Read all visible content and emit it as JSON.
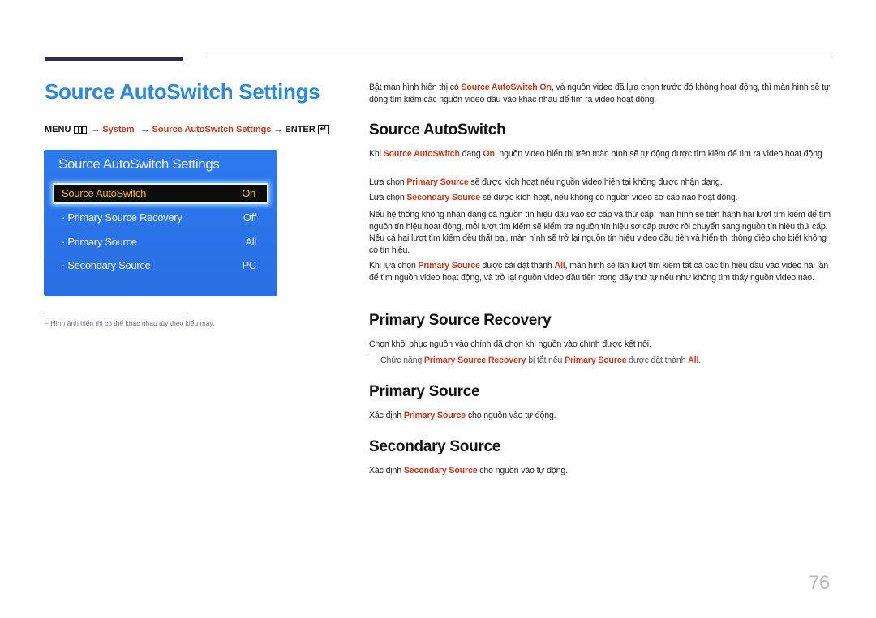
{
  "page": {
    "title": "Source AutoSwitch Settings",
    "page_number": "76"
  },
  "menu_path": {
    "menu_label": "MENU",
    "menu_icon": "menu-grid-icon",
    "arrow": "→",
    "step1": "System",
    "step2": "Source AutoSwitch Settings",
    "enter_label": "ENTER",
    "enter_icon": "enter-icon",
    "enter_glyph": "↵"
  },
  "osd": {
    "title": "Source AutoSwitch Settings",
    "rows": [
      {
        "label": "Source AutoSwitch",
        "value": "On",
        "selected": true
      },
      {
        "label": "· Primary Source Recovery",
        "value": "Off",
        "selected": false
      },
      {
        "label": "· Primary Source",
        "value": "All",
        "selected": false
      },
      {
        "label": "· Secondary Source",
        "value": "PC",
        "selected": false
      }
    ]
  },
  "footnote": "−  Hình ảnh hiển thị có thể khác nhau tùy theo kiểu máy.",
  "colors": {
    "title_blue": "#2a88e6",
    "highlight_red": "#c8381c",
    "osd_blue": "#2d79ee",
    "osd_selected_text": "#f2b820"
  },
  "intro": {
    "t1": "Bật màn hình hiển thị có ",
    "h1": "Source AutoSwitch On",
    "t2": ", và nguồn video đã lựa chọn trước đó không hoạt động, thì màn hình sẽ tự động tìm kiếm các nguồn video đầu vào khác nhau để tìm ra video hoạt động."
  },
  "sections": {
    "autoswitch": {
      "heading": "Source AutoSwitch",
      "p1": {
        "t1": "Khi ",
        "h1": "Source AutoSwitch",
        "t2": " đang ",
        "h2": "On",
        "t3": ", nguồn video hiển thị trên màn hình sẽ tự động được tìm kiếm để tìm ra video hoạt động."
      },
      "p2": {
        "t1": "Lựa chọn ",
        "h1": "Primary Source",
        "t2": " sẽ được kích hoạt nếu nguồn video hiện tại không được nhận dạng."
      },
      "p3": {
        "t1": "Lựa chọn ",
        "h1": "Secondary Source",
        "t2": " sẽ được kích hoạt, nếu không có nguồn video sơ cấp nào hoạt động."
      },
      "p4": "Nếu hệ thống không nhận dạng cả nguồn tín hiệu đầu vào sơ cấp và thứ cấp, màn hình sẽ tiến hành hai lượt tìm kiếm để tìm nguồn tín hiệu hoạt động, mỗi lượt tìm kiếm sẽ kiểm tra nguồn tín hiệu sơ cấp trước rồi chuyển sang nguồn tín hiệu thứ cấp. Nếu cả hai lượt tìm kiếm đều thất bại, màn hình sẽ trở lại nguồn tín hiệu video đầu tiên và hiển thị thông điệp cho biết không có tín hiệu.",
      "p5": {
        "t1": "Khi lựa chọn ",
        "h1": "Primary Source",
        "t2": " được cài đặt thành ",
        "h2": "All",
        "t3": ", màn hình sẽ lần lượt tìm kiếm tất cả các tín hiệu đầu vào video hai lần để tìm nguồn video hoạt động, và trở lại nguồn video đầu tiên trong dãy thứ tự nếu như không tìm thấy nguồn video nào."
      }
    },
    "recovery": {
      "heading": "Primary Source Recovery",
      "p1": "Chọn khôi phục nguồn vào chính đã chọn khi nguồn vào chính được kết nối.",
      "note": {
        "t1": "Chức năng ",
        "h1": "Primary Source Recovery",
        "t2": " bị tắt nếu ",
        "h2": "Primary Source",
        "t3": " được đặt thành ",
        "h3": "All",
        "t4": "."
      }
    },
    "primary": {
      "heading": "Primary Source",
      "p1": {
        "t1": "Xác định ",
        "h1": "Primary Source",
        "t2": " cho nguồn vào tự động."
      }
    },
    "secondary": {
      "heading": "Secondary Source",
      "p1": {
        "t1": "Xác định ",
        "h1": "Secondary Source",
        "t2": " cho nguồn vào tự động."
      }
    }
  }
}
